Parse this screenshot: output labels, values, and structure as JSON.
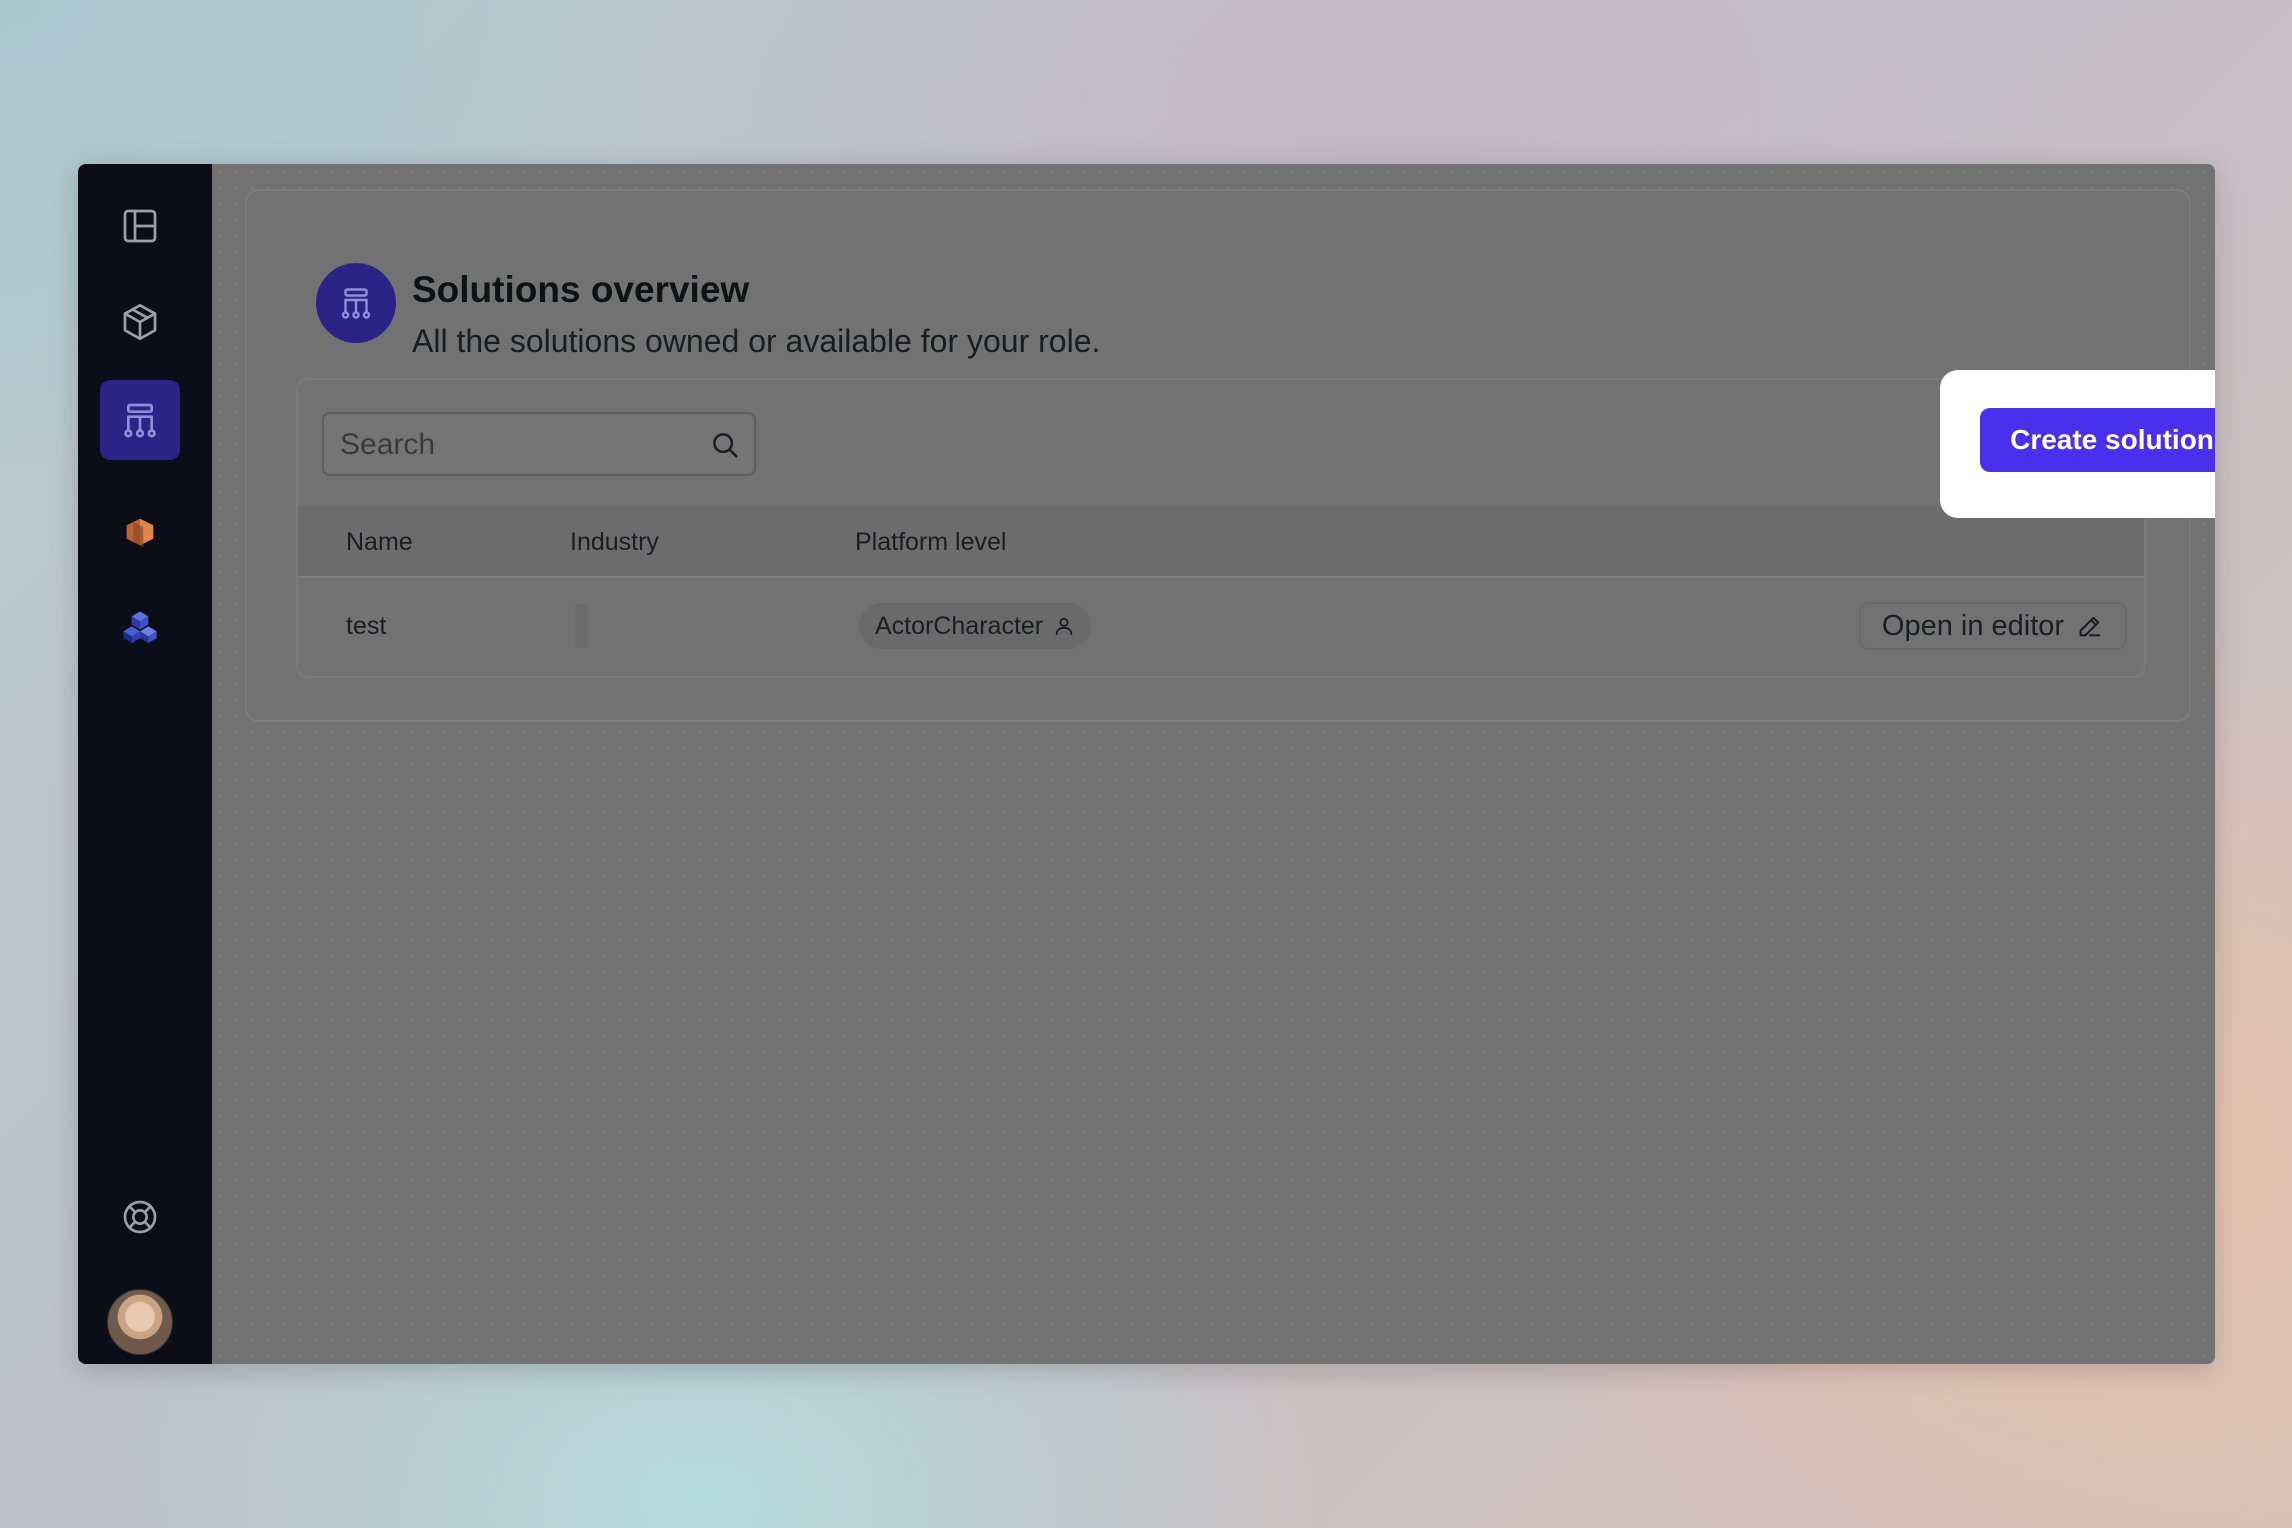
{
  "sidebar": {
    "items": [
      {
        "icon": "layout-icon",
        "active": false
      },
      {
        "icon": "box-icon",
        "active": false
      },
      {
        "icon": "hierarchy-icon",
        "active": true
      },
      {
        "icon": "orange-cube-logo",
        "active": false
      },
      {
        "icon": "blue-cubes-logo",
        "active": false
      }
    ],
    "help_icon": "lifebuoy-icon",
    "avatar": "user-avatar"
  },
  "header": {
    "title": "Solutions overview",
    "subtitle": "All the solutions owned or available for your role.",
    "icon": "hierarchy-icon"
  },
  "search": {
    "placeholder": "Search",
    "value": ""
  },
  "toolbar": {
    "create_label": "Create solution"
  },
  "table": {
    "columns": [
      "Name",
      "Industry",
      "Platform level"
    ],
    "rows": [
      {
        "name": "test",
        "industry": "",
        "platform_level": "ActorCharacter",
        "action_label": "Open in editor"
      }
    ]
  },
  "colors": {
    "sidebar_bg": "#0b0e17",
    "accent": "#4830ec",
    "active_nav": "#2b2486",
    "overlay": "#727272"
  }
}
